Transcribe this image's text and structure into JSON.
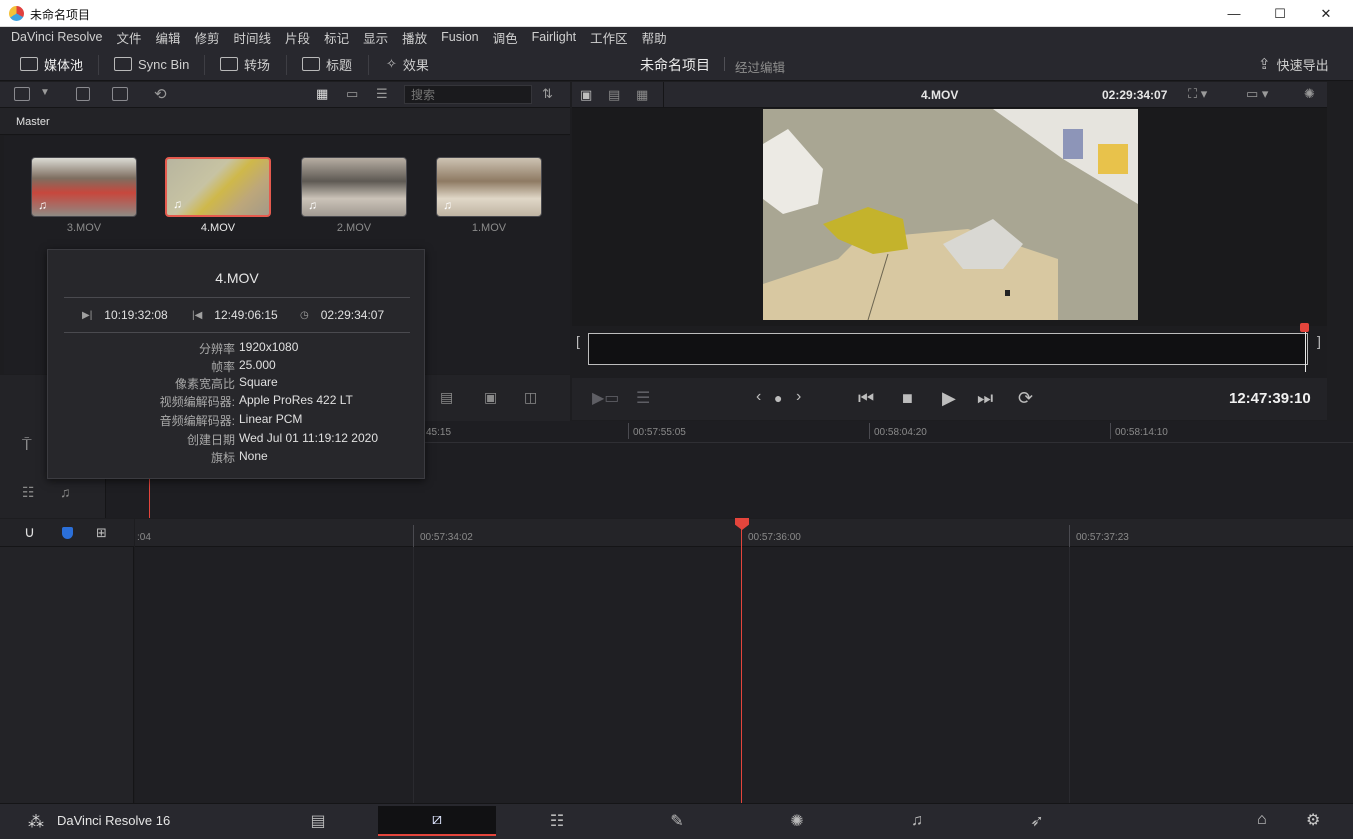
{
  "window": {
    "title": "未命名项目",
    "controls": {
      "minimize": "—",
      "maximize": "☐",
      "close": "✕"
    }
  },
  "menu": [
    "DaVinci Resolve",
    "文件",
    "编辑",
    "修剪",
    "时间线",
    "片段",
    "标记",
    "显示",
    "播放",
    "Fusion",
    "调色",
    "Fairlight",
    "工作区",
    "帮助"
  ],
  "toolbar": {
    "media_pool": "媒体池",
    "sync_bin": "Sync Bin",
    "transitions": "转场",
    "titles": "标题",
    "effects": "效果",
    "project_name": "未命名项目",
    "project_subtitle": "经过编辑",
    "quick_export": "快速导出"
  },
  "media_pool": {
    "search_placeholder": "搜索",
    "bin_name": "Master",
    "clips": [
      {
        "name": "3.MOV",
        "selected": false
      },
      {
        "name": "4.MOV",
        "selected": true
      },
      {
        "name": "2.MOV",
        "selected": false
      },
      {
        "name": "1.MOV",
        "selected": false
      }
    ]
  },
  "tooltip": {
    "title": "4.MOV",
    "in_tc": "10:19:32:08",
    "out_tc": "12:49:06:15",
    "duration_tc": "02:29:34:07",
    "props": [
      {
        "key": "分辨率",
        "value": "1920x1080"
      },
      {
        "key": "帧率",
        "value": "25.000"
      },
      {
        "key": "像素宽高比",
        "value": "Square"
      },
      {
        "key": "视频编解码器:",
        "value": "Apple ProRes 422 LT"
      },
      {
        "key": "音频编解码器:",
        "value": "Linear PCM"
      },
      {
        "key": "创建日期",
        "value": "Wed Jul 01 11:19:12 2020"
      },
      {
        "key": "旗标",
        "value": "None"
      }
    ]
  },
  "viewer": {
    "clip_name": "4.MOV",
    "duration_tc": "02:29:34:07",
    "current_tc": "12:47:39:10"
  },
  "timeline_upper": {
    "labels": [
      "45:15",
      "00:57:55:05",
      "00:58:04:20",
      "00:58:14:10"
    ]
  },
  "timeline_lower": {
    "labels": [
      ":04",
      "00:57:34:02",
      "00:57:36:00",
      "00:57:37:23"
    ]
  },
  "pagebar": {
    "brand": "DaVinci Resolve 16",
    "pages": [
      "media",
      "cut",
      "edit",
      "fusion",
      "color",
      "fairlight",
      "deliver"
    ],
    "active_page": "cut"
  },
  "colors": {
    "accent": "#e4453c",
    "panel": "#28282e",
    "background": "#1d1d20"
  }
}
